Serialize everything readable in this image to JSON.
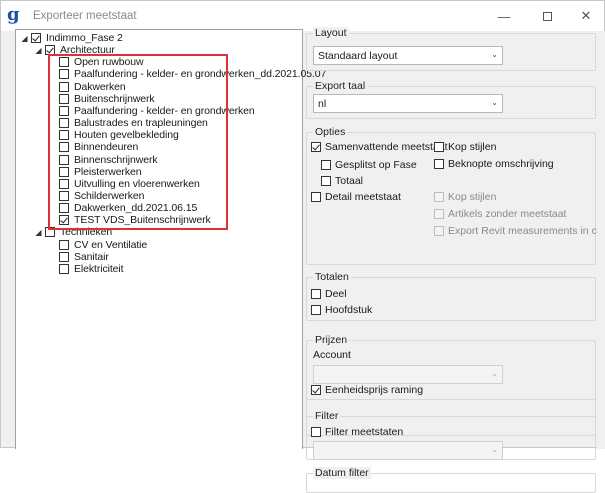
{
  "window": {
    "title": "Exporteer meetstaat",
    "app_icon_glyph": "g",
    "minimize_glyph": "—",
    "close_glyph": "✕"
  },
  "tree": {
    "root": {
      "label": "Indimmo_Fase 2",
      "checked": true,
      "expander": "◢"
    },
    "architectuur": {
      "label": "Architectuur",
      "checked": true,
      "expander": "◢",
      "items": [
        {
          "label": "Open ruwbouw",
          "checked": false
        },
        {
          "label": "Paalfundering - kelder- en grondwerken_dd.2021.05.07",
          "checked": false
        },
        {
          "label": "Dakwerken",
          "checked": false
        },
        {
          "label": "Buitenschrijnwerk",
          "checked": false
        },
        {
          "label": "Paalfundering - kelder- en grondwerken",
          "checked": false
        },
        {
          "label": "Balustrades en trapleuningen",
          "checked": false
        },
        {
          "label": "Houten gevelbekleding",
          "checked": false
        },
        {
          "label": "Binnendeuren",
          "checked": false
        },
        {
          "label": "Binnenschrijnwerk",
          "checked": false
        },
        {
          "label": "Pleisterwerken",
          "checked": false
        },
        {
          "label": "Uitvulling en vloerenwerken",
          "checked": false
        },
        {
          "label": "Schilderwerken",
          "checked": false
        },
        {
          "label": "Dakwerken_dd.2021.06.15",
          "checked": false
        },
        {
          "label": "TEST VDS_Buitenschrijnwerk",
          "checked": true
        }
      ]
    },
    "technieken": {
      "label": "Technieken",
      "checked": false,
      "expander": "◢",
      "items": [
        {
          "label": "CV en Ventilatie",
          "checked": false
        },
        {
          "label": "Sanitair",
          "checked": false
        },
        {
          "label": "Elektriciteit",
          "checked": false
        }
      ]
    },
    "highlight_color": "#e0303a"
  },
  "layout_group": {
    "title": "Layout",
    "value": "Standaard layout"
  },
  "export_taal_group": {
    "title": "Export taal",
    "value": "nl"
  },
  "opties_group": {
    "title": "Opties",
    "samenvattende": {
      "label": "Samenvattende meetstaat",
      "checked": true
    },
    "gesplitst": {
      "label": "Gesplitst op Fase",
      "checked": false
    },
    "totaal": {
      "label": "Totaal",
      "checked": false
    },
    "detail": {
      "label": "Detail meetstaat",
      "checked": false
    },
    "kop_stijlen_1": {
      "label": "Kop stijlen",
      "checked": false
    },
    "beknopte": {
      "label": "Beknopte omschrijving",
      "checked": false
    },
    "kop_stijlen_2": {
      "label": "Kop stijlen",
      "checked": false,
      "enabled": false
    },
    "artikels": {
      "label": "Artikels zonder meetstaat",
      "checked": false,
      "enabled": false
    },
    "export_revit": {
      "label": "Export Revit measurements in color",
      "checked": false,
      "enabled": false
    }
  },
  "totalen_group": {
    "title": "Totalen",
    "deel": {
      "label": "Deel",
      "checked": false
    },
    "hoofdstuk": {
      "label": "Hoofdstuk",
      "checked": false
    }
  },
  "prijzen_group": {
    "title": "Prijzen",
    "account_label": "Account",
    "account_value": "",
    "eenheidsprijs": {
      "label": "Eenheidsprijs raming",
      "checked": true
    }
  },
  "filter_group": {
    "title": "Filter",
    "filter_meetstaten": {
      "label": "Filter meetstaten",
      "checked": false
    },
    "filter_value": ""
  },
  "datum_filter_group": {
    "title": "Datum filter"
  },
  "combo_arrow_glyph": "⌄"
}
